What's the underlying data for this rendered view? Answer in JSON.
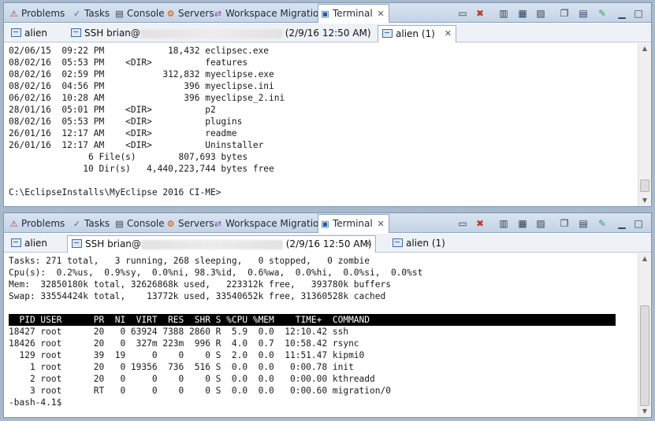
{
  "view_tabs": [
    {
      "label": "Problems",
      "icon": "problems-icon",
      "glyph": "⚠"
    },
    {
      "label": "Tasks",
      "icon": "tasks-icon",
      "glyph": "✓"
    },
    {
      "label": "Console",
      "icon": "console-icon",
      "glyph": "▤"
    },
    {
      "label": "Servers",
      "icon": "servers-icon",
      "glyph": "⚙"
    },
    {
      "label": "Workspace Migration",
      "icon": "migration-icon",
      "glyph": "⇄"
    },
    {
      "label": "Terminal",
      "icon": "terminal-icon",
      "glyph": "▣"
    }
  ],
  "toolbar": {
    "icons": [
      "minimize-all-icon",
      "disconnect-icon",
      "new-terminal-icon",
      "settings-icon",
      "filter-icon",
      "copy-icon",
      "paste-icon",
      "edit-icon",
      "minimize-icon",
      "maximize-icon"
    ],
    "glyphs": [
      "▭",
      "✖",
      "▥",
      "▦",
      "▨",
      "❐",
      "▤",
      "✎",
      "▁",
      "□"
    ]
  },
  "top_view": {
    "sessions": [
      {
        "label": "alien"
      },
      {
        "label_prefix": "SSH brian@",
        "redacted": "host",
        "label_suffix": "(2/9/16 12:50 AM)"
      },
      {
        "label": "alien (1)"
      }
    ],
    "lines": [
      "02/06/15  09:22 PM            18,432 eclipsec.exe",
      "08/02/16  05:53 PM    <DIR>          features",
      "08/02/16  02:59 PM           312,832 myeclipse.exe",
      "08/02/16  04:56 PM               396 myeclipse.ini",
      "06/02/16  10:28 AM               396 myeclipse_2.ini",
      "28/01/16  05:01 PM    <DIR>          p2",
      "08/02/16  05:53 PM    <DIR>          plugins",
      "26/01/16  12:17 AM    <DIR>          readme",
      "26/01/16  12:17 AM    <DIR>          Uninstaller",
      "               6 File(s)        807,693 bytes",
      "              10 Dir(s)   4,440,223,744 bytes free",
      "",
      "C:\\EclipseInstalls\\MyEclipse 2016 CI-ME>"
    ]
  },
  "bottom_view": {
    "sessions": [
      {
        "label": "alien"
      },
      {
        "label_prefix": "SSH brian@",
        "redacted": "host",
        "label_suffix": "(2/9/16 12:50 AM)"
      },
      {
        "label": "alien (1)"
      }
    ],
    "lines_before": [
      "Tasks: 271 total,   3 running, 268 sleeping,   0 stopped,   0 zombie",
      "Cpu(s):  0.2%us,  0.9%sy,  0.0%ni, 98.3%id,  0.6%wa,  0.0%hi,  0.0%si,  0.0%st",
      "Mem:  32850180k total, 32626868k used,   223312k free,   393780k buffers",
      "Swap: 33554424k total,    13772k used, 33540652k free, 31360528k cached",
      ""
    ],
    "header_line": "  PID USER      PR  NI  VIRT  RES  SHR S %CPU %MEM    TIME+  COMMAND",
    "lines_after": [
      "18427 root      20   0 63924 7388 2860 R  5.9  0.0  12:10.42 ssh",
      "18426 root      20   0  327m 223m  996 R  4.0  0.7  10:58.42 rsync",
      "  129 root      39  19     0    0    0 S  2.0  0.0  11:51.47 kipmi0",
      "    1 root      20   0 19356  736  516 S  0.0  0.0   0:00.78 init",
      "    2 root      20   0     0    0    0 S  0.0  0.0   0:00.00 kthreadd",
      "    3 root      RT   0     0    0    0 S  0.0  0.0   0:00.60 migration/0",
      "-bash-4.1$"
    ]
  }
}
